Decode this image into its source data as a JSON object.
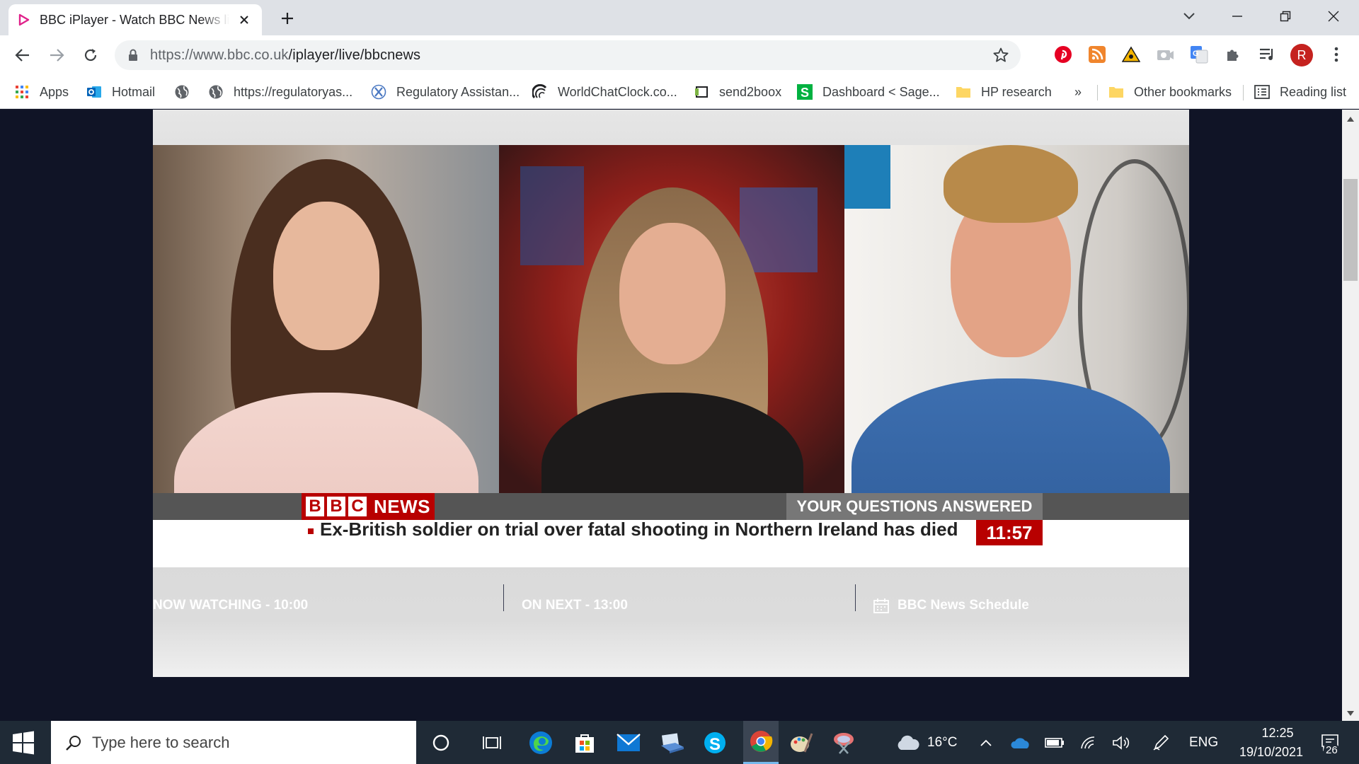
{
  "tab": {
    "title": "BBC iPlayer - Watch BBC News live"
  },
  "address": {
    "host": "https://www.bbc.co.uk",
    "path": "/iplayer/live/bbcnews"
  },
  "bookmarks": [
    {
      "label": "Apps"
    },
    {
      "label": "Hotmail"
    },
    {
      "label": ""
    },
    {
      "label": "https://regulatoryas..."
    },
    {
      "label": "Regulatory Assistan..."
    },
    {
      "label": "WorldChatClock.co..."
    },
    {
      "label": "send2boox"
    },
    {
      "label": "Dashboard < Sage..."
    },
    {
      "label": "HP research"
    }
  ],
  "bookmarks_more": "»",
  "other_bookmarks": "Other bookmarks",
  "reading_list": "Reading list",
  "profile_initial": "R",
  "broadcast": {
    "channel_letters": [
      "B",
      "B",
      "C"
    ],
    "channel_word": "NEWS",
    "programme": "YOUR QUESTIONS ANSWERED",
    "headline": "Ex-British soldier on trial over fatal shooting in Northern Ireland has died",
    "clock": "11:57"
  },
  "schedule": {
    "now_watching": "NOW WATCHING - 10:00",
    "on_next": "ON NEXT - 13:00",
    "schedule_link": "BBC News Schedule"
  },
  "taskbar": {
    "search_placeholder": "Type here to search",
    "weather": "16°C",
    "language": "ENG",
    "time": "12:25",
    "date": "19/10/2021",
    "notifications": "26"
  },
  "colors": {
    "bbc_red": "#b80000",
    "taskbar": "#1f2a36",
    "page_bg": "#101426"
  }
}
